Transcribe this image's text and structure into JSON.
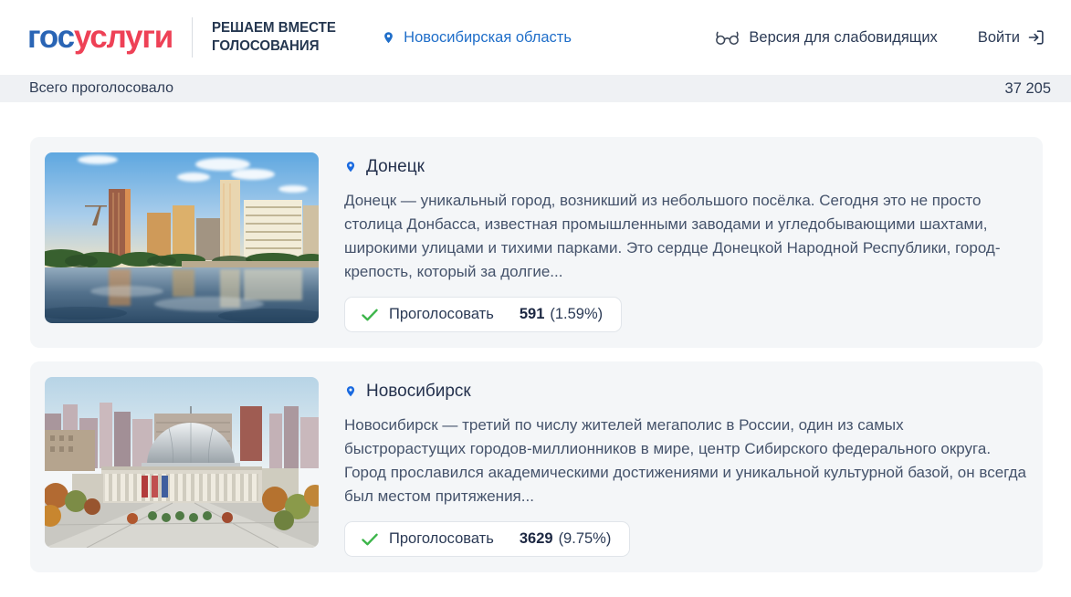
{
  "header": {
    "logo": {
      "part1": "гос",
      "part2": "услуги"
    },
    "portal_title_line1": "РЕШАЕМ ВМЕСТЕ",
    "portal_title_line2": "ГОЛОСОВАНИЯ",
    "region": "Новосибирская область",
    "accessibility_label": "Версия для слабовидящих",
    "login_label": "Войти"
  },
  "totals": {
    "label": "Всего проголосовало",
    "value": "37 205"
  },
  "cards": [
    {
      "city": "Донецк",
      "photo_alt": "donetsk-riverfront-sunset-photo",
      "description": "Донецк — уникальный город, возникший из небольшого посёлка. Сегодня это не просто столица Донбасса, известная промышленными заводами и угледобывающими шахтами, широкими улицами и тихими парками. Это сердце Донецкой Народной Республики, город-крепость, который за долгие...",
      "vote_label": "Проголосовать",
      "votes": "591",
      "percent": "(1.59%)"
    },
    {
      "city": "Новосибирск",
      "photo_alt": "novosibirsk-opera-house-photo",
      "description": "Новосибирск — третий по числу жителей мегаполис в России, один из самых быстрорастущих городов-миллионников в мире, центр Сибирского федерального округа. Город прославился академическими достижениями и уникальной культурной базой, он всегда был местом притяжения...",
      "vote_label": "Проголосовать",
      "votes": "3629",
      "percent": "(9.75%)"
    }
  ],
  "icons": {
    "location_pin": "location-pin-icon",
    "glasses": "eyeglasses-icon",
    "login_arrow": "login-arrow-icon",
    "check": "green-check-icon"
  },
  "colors": {
    "brand_blue": "#2a65b5",
    "brand_red": "#ee4156",
    "link_blue": "#1f6ec9",
    "check_green": "#3cb54a",
    "card_background": "#f4f6f8",
    "header_text": "#2b3a55"
  }
}
